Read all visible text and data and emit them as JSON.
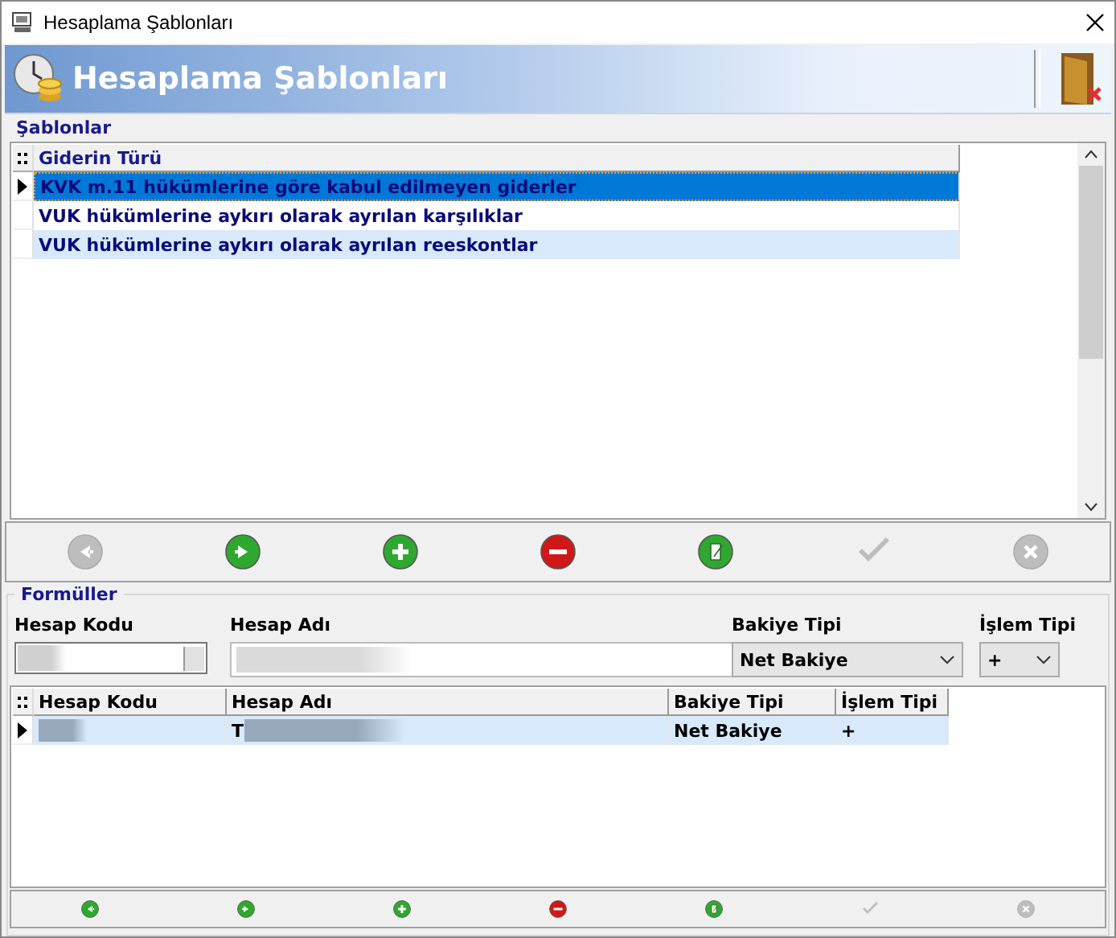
{
  "window": {
    "title": "Hesaplama Şablonları"
  },
  "header": {
    "title": "Hesaplama Şablonları"
  },
  "templates": {
    "legend": "Şablonlar",
    "columns": [
      "Giderin Türü"
    ],
    "rows": [
      {
        "cells": [
          "KVK m.11 hükümlerine göre kabul edilmeyen giderler"
        ],
        "selected": true
      },
      {
        "cells": [
          "VUK hükümlerine aykırı olarak ayrılan karşılıklar"
        ],
        "selected": false
      },
      {
        "cells": [
          "VUK hükümlerine aykırı olarak ayrılan reeskontlar"
        ],
        "selected": false
      }
    ]
  },
  "toolbar": [
    {
      "kind": "prev",
      "disabled": true
    },
    {
      "kind": "next",
      "disabled": false
    },
    {
      "kind": "add",
      "disabled": false
    },
    {
      "kind": "delete",
      "disabled": false
    },
    {
      "kind": "edit",
      "disabled": false
    },
    {
      "kind": "confirm",
      "disabled": true
    },
    {
      "kind": "cancel",
      "disabled": true
    }
  ],
  "formulas": {
    "legend": "Formüller",
    "fields": [
      {
        "kind": "lookup",
        "label": "Hesap Kodu"
      },
      {
        "kind": "text",
        "label": "Hesap Adı"
      },
      {
        "kind": "select",
        "label": "Bakiye Tipi",
        "value": "Net Bakiye"
      },
      {
        "kind": "select",
        "label": "İşlem Tipi",
        "value": "+"
      }
    ],
    "columns": [
      "Hesap Kodu",
      "Hesap Adı",
      "Bakiye Tipi",
      "İşlem Tipi"
    ],
    "rows": [
      {
        "cells": [
          {
            "kind": "redacted"
          },
          {
            "kind": "partial",
            "text": "T"
          },
          {
            "kind": "text",
            "text": "Net Bakiye"
          },
          {
            "kind": "text",
            "text": "+"
          }
        ],
        "selected": true
      }
    ],
    "toolbar": [
      {
        "kind": "prev",
        "disabled": false
      },
      {
        "kind": "next",
        "disabled": false
      },
      {
        "kind": "add",
        "disabled": false
      },
      {
        "kind": "delete",
        "disabled": false
      },
      {
        "kind": "edit",
        "disabled": false
      },
      {
        "kind": "confirm",
        "disabled": true
      },
      {
        "kind": "cancel",
        "disabled": true
      }
    ]
  }
}
